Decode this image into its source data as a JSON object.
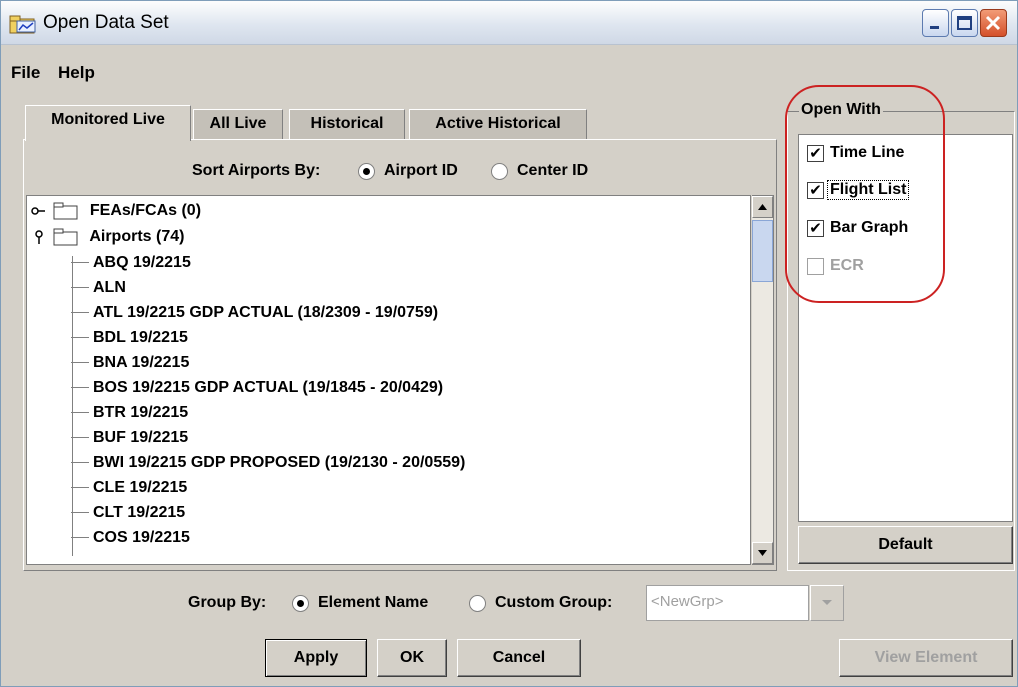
{
  "window": {
    "title": "Open Data Set",
    "icon": "folder-chart-icon",
    "minimize_icon": "minimize-icon",
    "maximize_icon": "maximize-icon",
    "close_icon": "close-icon"
  },
  "menu": {
    "file": "File",
    "help": "Help"
  },
  "tabs": [
    {
      "label": "Monitored Live",
      "active": true
    },
    {
      "label": "All Live",
      "active": false
    },
    {
      "label": "Historical",
      "active": false
    },
    {
      "label": "Active Historical",
      "active": false
    }
  ],
  "sort": {
    "label": "Sort Airports By:",
    "options": [
      {
        "label": "Airport ID",
        "selected": true
      },
      {
        "label": "Center ID",
        "selected": false
      }
    ]
  },
  "tree": {
    "roots": [
      {
        "label": "FEAs/FCAs (0)",
        "expanded": false
      },
      {
        "label": "Airports (74)",
        "expanded": true
      }
    ],
    "children": [
      "ABQ 19/2215",
      "ALN",
      "ATL 19/2215 GDP ACTUAL (18/2309 - 19/0759)",
      "BDL 19/2215",
      "BNA 19/2215",
      "BOS 19/2215 GDP ACTUAL (19/1845 - 20/0429)",
      "BTR 19/2215",
      "BUF 19/2215",
      "BWI 19/2215 GDP PROPOSED (19/2130 - 20/0559)",
      "CLE 19/2215",
      "CLT 19/2215",
      "COS 19/2215"
    ]
  },
  "open_with": {
    "title": "Open With",
    "options": [
      {
        "label": "Time Line",
        "checked": true,
        "enabled": true
      },
      {
        "label": "Flight List",
        "checked": true,
        "enabled": true
      },
      {
        "label": "Bar Graph",
        "checked": true,
        "enabled": true
      },
      {
        "label": "ECR",
        "checked": false,
        "enabled": false
      }
    ],
    "default_button": "Default"
  },
  "group_by": {
    "label": "Group By:",
    "options": [
      {
        "label": "Element Name",
        "selected": true
      },
      {
        "label": "Custom Group:",
        "selected": false
      }
    ],
    "custom_group_value": "<NewGrp>"
  },
  "buttons": {
    "apply": "Apply",
    "ok": "OK",
    "cancel": "Cancel",
    "view_element": "View Element"
  },
  "colors": {
    "annotation_circle": "#cc2222",
    "window_bg": "#d4d0c8"
  }
}
